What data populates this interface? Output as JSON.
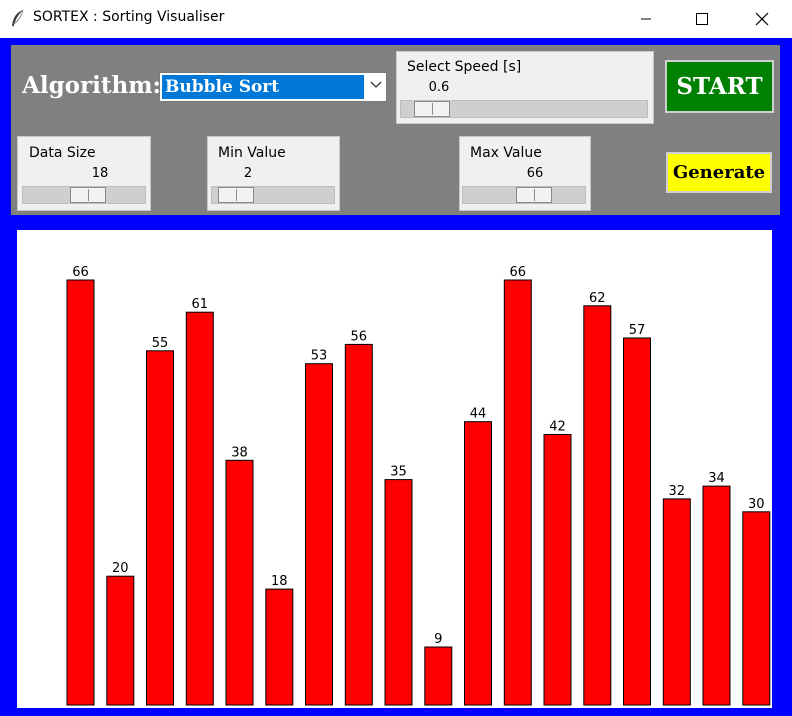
{
  "window": {
    "title": "SORTEX : Sorting Visualiser"
  },
  "controls": {
    "algorithm_label": "Algorithm:",
    "algorithm_selected": "Bubble Sort",
    "speed": {
      "label": "Select Speed [s]",
      "value": "0.6",
      "fraction": 0.06
    },
    "data_size": {
      "label": "Data Size",
      "value": "18",
      "fraction": 0.55
    },
    "min_value": {
      "label": "Min Value",
      "value": "2",
      "fraction": 0.07
    },
    "max_value": {
      "label": "Max Value",
      "value": "66",
      "fraction": 0.62
    },
    "start_label": "START",
    "generate_label": "Generate"
  },
  "colors": {
    "frame": "#0000ff",
    "panel": "#808080",
    "bar": "#ff0000",
    "start": "#008000",
    "generate": "#ffff00",
    "selection": "#0078d7"
  },
  "chart_data": {
    "type": "bar",
    "values": [
      66,
      20,
      55,
      61,
      38,
      18,
      53,
      56,
      35,
      9,
      44,
      66,
      42,
      62,
      57,
      32,
      34,
      30
    ],
    "ylim": [
      0,
      66
    ]
  }
}
